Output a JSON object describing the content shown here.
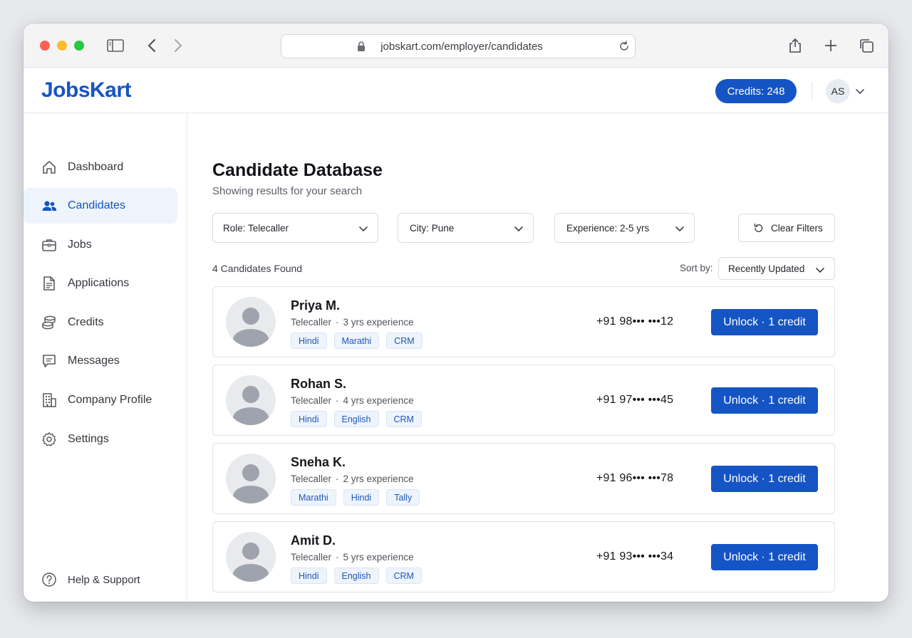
{
  "browser": {
    "url": "jobskart.com/employer/candidates"
  },
  "header": {
    "logo": "JobsKart",
    "credits": "Credits: 248",
    "user_initials": "AS"
  },
  "sidebar": {
    "items": [
      {
        "label": "Dashboard",
        "icon": "home-icon"
      },
      {
        "label": "Candidates",
        "icon": "users-icon",
        "active": true
      },
      {
        "label": "Jobs",
        "icon": "briefcase-icon"
      },
      {
        "label": "Applications",
        "icon": "document-icon"
      },
      {
        "label": "Credits",
        "icon": "coins-icon"
      },
      {
        "label": "Messages",
        "icon": "message-icon"
      },
      {
        "label": "Company Profile",
        "icon": "building-icon"
      },
      {
        "label": "Settings",
        "icon": "gear-icon"
      }
    ],
    "help": {
      "label": "Help & Support",
      "icon": "help-icon"
    }
  },
  "main": {
    "title": "Candidate Database",
    "subtitle": "Showing results for your search",
    "filters": {
      "role": "Role: Telecaller",
      "city": "City: Pune",
      "experience": "Experience: 2-5 yrs",
      "clear": "Clear Filters"
    },
    "count": "4 Candidates Found",
    "sort": {
      "label": "Sort by:",
      "value": "Recently Updated"
    },
    "candidates": [
      {
        "name": "Priya M.",
        "role": "Telecaller",
        "experience": "3 yrs experience",
        "tags": [
          "Hindi",
          "Marathi",
          "CRM"
        ],
        "phone": "+91 98••• •••12",
        "action": "Unlock · 1 credit"
      },
      {
        "name": "Rohan S.",
        "role": "Telecaller",
        "experience": "4 yrs experience",
        "tags": [
          "Hindi",
          "English",
          "CRM"
        ],
        "phone": "+91 97••• •••45",
        "action": "Unlock · 1 credit"
      },
      {
        "name": "Sneha K.",
        "role": "Telecaller",
        "experience": "2 yrs experience",
        "tags": [
          "Marathi",
          "Hindi",
          "Tally"
        ],
        "phone": "+91 96••• •••78",
        "action": "Unlock · 1 credit"
      },
      {
        "name": "Amit D.",
        "role": "Telecaller",
        "experience": "5 yrs experience",
        "tags": [
          "Hindi",
          "English",
          "CRM"
        ],
        "phone": "+91 93••• •••34",
        "action": "Unlock · 1 credit"
      }
    ]
  },
  "colors": {
    "brand": "#1554c4",
    "active_nav_bg": "#eef4fc",
    "tag_bg": "#eef4fc"
  }
}
